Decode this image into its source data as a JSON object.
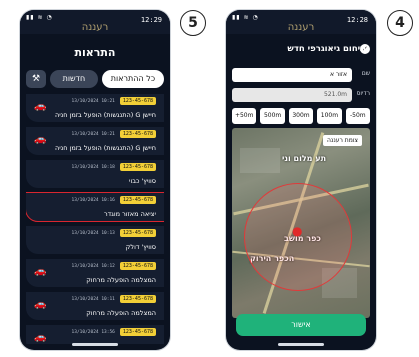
{
  "steps": {
    "left": "5",
    "right": "4"
  },
  "phone_alerts": {
    "status": {
      "time": "12:29",
      "app_title": "רעננה"
    },
    "header": "התראות",
    "tabs": {
      "all": "כל ההתראות",
      "new": "חדשות"
    },
    "items": [
      {
        "plate": "123-45-678",
        "datetime": "13/10/2024 10:21",
        "title": "חיישן G (התנגשות) הופעל בזמן חניה",
        "icon": "vehicle-icon",
        "highlight": false
      },
      {
        "plate": "123-45-678",
        "datetime": "13/10/2024 10:21",
        "title": "חיישן G (התנגשות) הופעל בזמן חניה",
        "icon": "vehicle-icon",
        "highlight": false
      },
      {
        "plate": "123-45-678",
        "datetime": "13/10/2024 10:18",
        "title": "סוויץ' כבוי",
        "icon": "",
        "highlight": false
      },
      {
        "plate": "123-45-678",
        "datetime": "13/10/2024 10:16",
        "title": "יציאה מאזור מוגדר",
        "icon": "",
        "highlight": true
      },
      {
        "plate": "123-45-678",
        "datetime": "13/10/2024 10:13",
        "title": "סוויץ' דולק",
        "icon": "",
        "highlight": false
      },
      {
        "plate": "123-45-678",
        "datetime": "13/10/2024 10:12",
        "title": "המצלמה הופעלה מרחוק",
        "icon": "vehicle-icon",
        "highlight": false
      },
      {
        "plate": "123-45-678",
        "datetime": "13/10/2024 10:11",
        "title": "המצלמה הופעלה מרחוק",
        "icon": "vehicle-icon",
        "highlight": false
      },
      {
        "plate": "123-45-678",
        "datetime": "13/10/2024 13:56",
        "title": "",
        "icon": "vehicle-icon",
        "highlight": false
      }
    ]
  },
  "phone_geo": {
    "status": {
      "time": "12:28",
      "app_title": "רעננה"
    },
    "header": "תיחום גיאוגרפי חדש",
    "name_label": "שם",
    "name_value": "אזור א",
    "radius_label": "רדיוס",
    "radius_value": "521.0m",
    "buttons": [
      "+50m",
      "500m",
      "300m",
      "100m",
      "-50m"
    ],
    "map_label": "צומת רעננה",
    "map_texts": [
      {
        "text": "תע מלום וני"
      },
      {
        "text": "כפר מושב"
      },
      {
        "text": "הכפר הירוק"
      }
    ],
    "approve": "אישור"
  }
}
